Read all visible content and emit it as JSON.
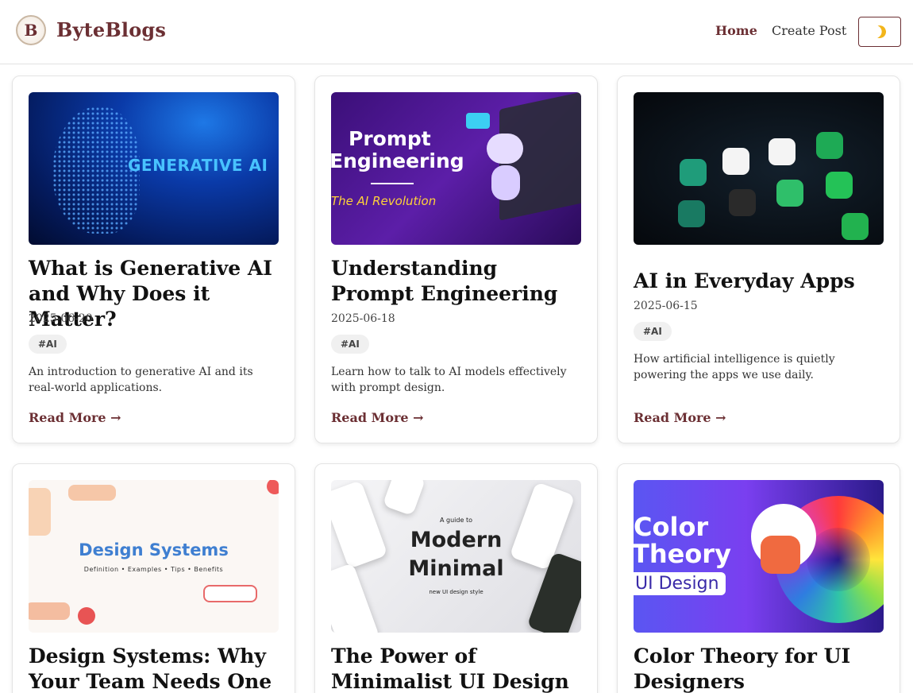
{
  "header": {
    "logo_letter": "B",
    "brand": "ByteBlogs",
    "nav": {
      "home": "Home",
      "create": "Create Post"
    },
    "theme_toggle_icon": "moon-icon"
  },
  "posts": [
    {
      "title": "What is Generative AI and Why Does it Matter?",
      "date": "2025-06-20",
      "tag": "#AI",
      "description": "An introduction to generative AI and its real-world applications.",
      "read_more": "Read More →",
      "thumb": {
        "label": "GENERATIVE AI"
      }
    },
    {
      "title": "Understanding Prompt Engineering",
      "date": "2025-06-18",
      "tag": "#AI",
      "description": "Learn how to talk to AI models effectively with prompt design.",
      "read_more": "Read More →",
      "thumb": {
        "line1": "Prompt",
        "line2": "Engineering",
        "line3": "The AI Revolution"
      }
    },
    {
      "title": "AI in Everyday Apps",
      "date": "2025-06-15",
      "tag": "#AI",
      "description": "How artificial intelligence is quietly powering the apps we use daily.",
      "read_more": "Read More →",
      "thumb": {}
    },
    {
      "title": "Design Systems: Why Your Team Needs One",
      "thumb": {
        "label": "Design Systems",
        "sub": "Definition  •  Examples  •  Tips  •  Benefits"
      }
    },
    {
      "title": "The Power of Minimalist UI Design",
      "thumb": {
        "small": "A guide to",
        "big1": "Modern",
        "big2": "Minimal",
        "tiny": "new UI design style"
      }
    },
    {
      "title": "Color Theory for UI Designers",
      "thumb": {
        "line1": "Color",
        "line2": "Theory",
        "pill": "UI Design"
      }
    }
  ]
}
